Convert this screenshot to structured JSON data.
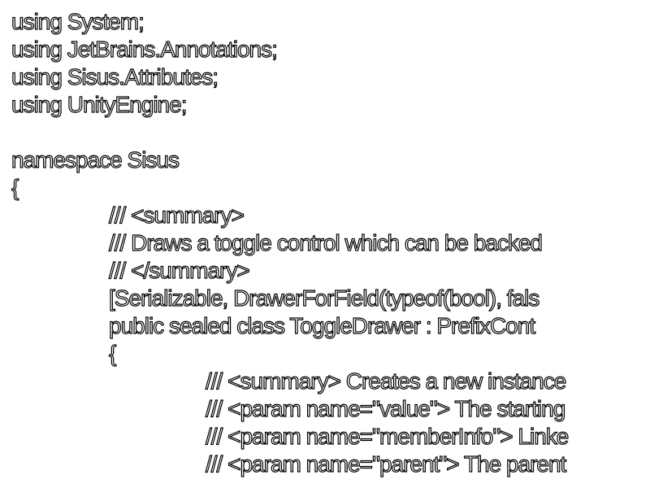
{
  "editor": {
    "text_color": "#ffffff",
    "outline_color": "#000000",
    "background": "#ffffff",
    "lines": [
      "using System;",
      "using JetBrains.Annotations;",
      "using Sisus.Attributes;",
      "using UnityEngine;",
      "",
      "namespace Sisus",
      "{",
      "/// <summary>",
      "/// Draws a toggle control which can be backed",
      "/// </summary>",
      "[Serializable, DrawerForField(typeof(bool), fals",
      "public sealed class ToggleDrawer : PrefixCont",
      "{",
      "/// <summary> Creates a new instance",
      "/// <param name=\"value\"> The starting",
      "/// <param name=\"memberInfo\"> Linke",
      "/// <param name=\"parent\"> The parent"
    ]
  }
}
